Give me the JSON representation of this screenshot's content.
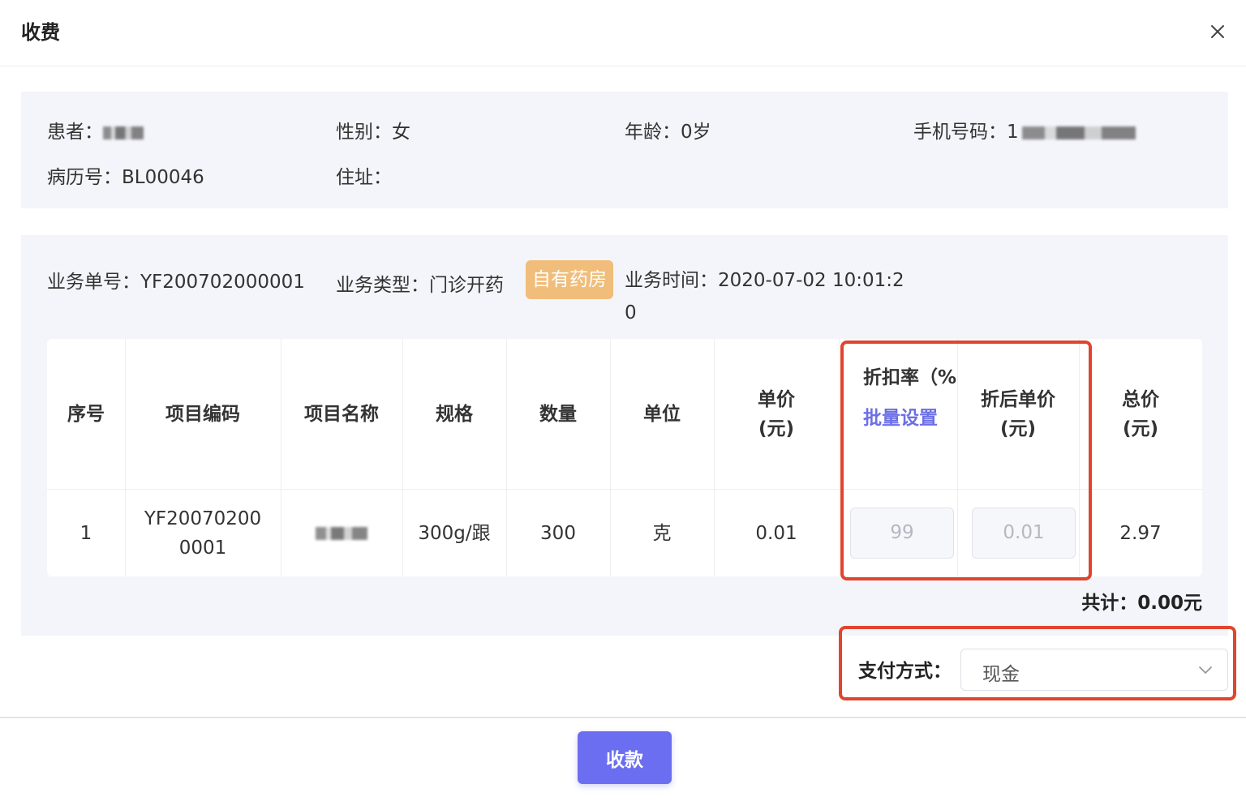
{
  "dialog": {
    "title": "收费"
  },
  "patient": {
    "name_label": "患者：",
    "gender_label": "性别：",
    "gender": "女",
    "age_label": "年龄：",
    "age": "0岁",
    "phone_label": "手机号码：",
    "phone_visible": "1",
    "record_label": "病历号：",
    "record": "BL00046",
    "address_label": "住址：",
    "address": ""
  },
  "order": {
    "no_label": "业务单号：",
    "no": "YF200702000001",
    "type_label": "业务类型：",
    "type": "门诊开药",
    "tag": "自有药房",
    "time_label": "业务时间：",
    "time": "2020-07-02 10:01:20"
  },
  "table": {
    "headers": {
      "index": "序号",
      "code": "项目编码",
      "name": "项目名称",
      "spec": "规格",
      "qty": "数量",
      "unit": "单位",
      "price_1": "单价",
      "price_2": "(元)",
      "discount": "折扣率（%",
      "batch": "批量设置",
      "disc_price_1": "折后单价",
      "disc_price_2": "(元)",
      "total_1": "总价",
      "total_2": "(元)"
    },
    "rows": [
      {
        "index": "1",
        "code": "YF200702000001",
        "spec": "300g/跟",
        "qty": "300",
        "unit": "克",
        "price": "0.01",
        "discount": "99",
        "disc_price": "0.01",
        "total": "2.97"
      }
    ]
  },
  "summary": {
    "label": "共计：",
    "value": "0.00元"
  },
  "payment": {
    "label": "支付方式：",
    "selected": "现金"
  },
  "actions": {
    "submit": "收款"
  },
  "colors": {
    "accent": "#6b6ef0",
    "tag": "#f0bd7b",
    "highlight": "#e0452d",
    "panel": "#f4f5fa"
  }
}
